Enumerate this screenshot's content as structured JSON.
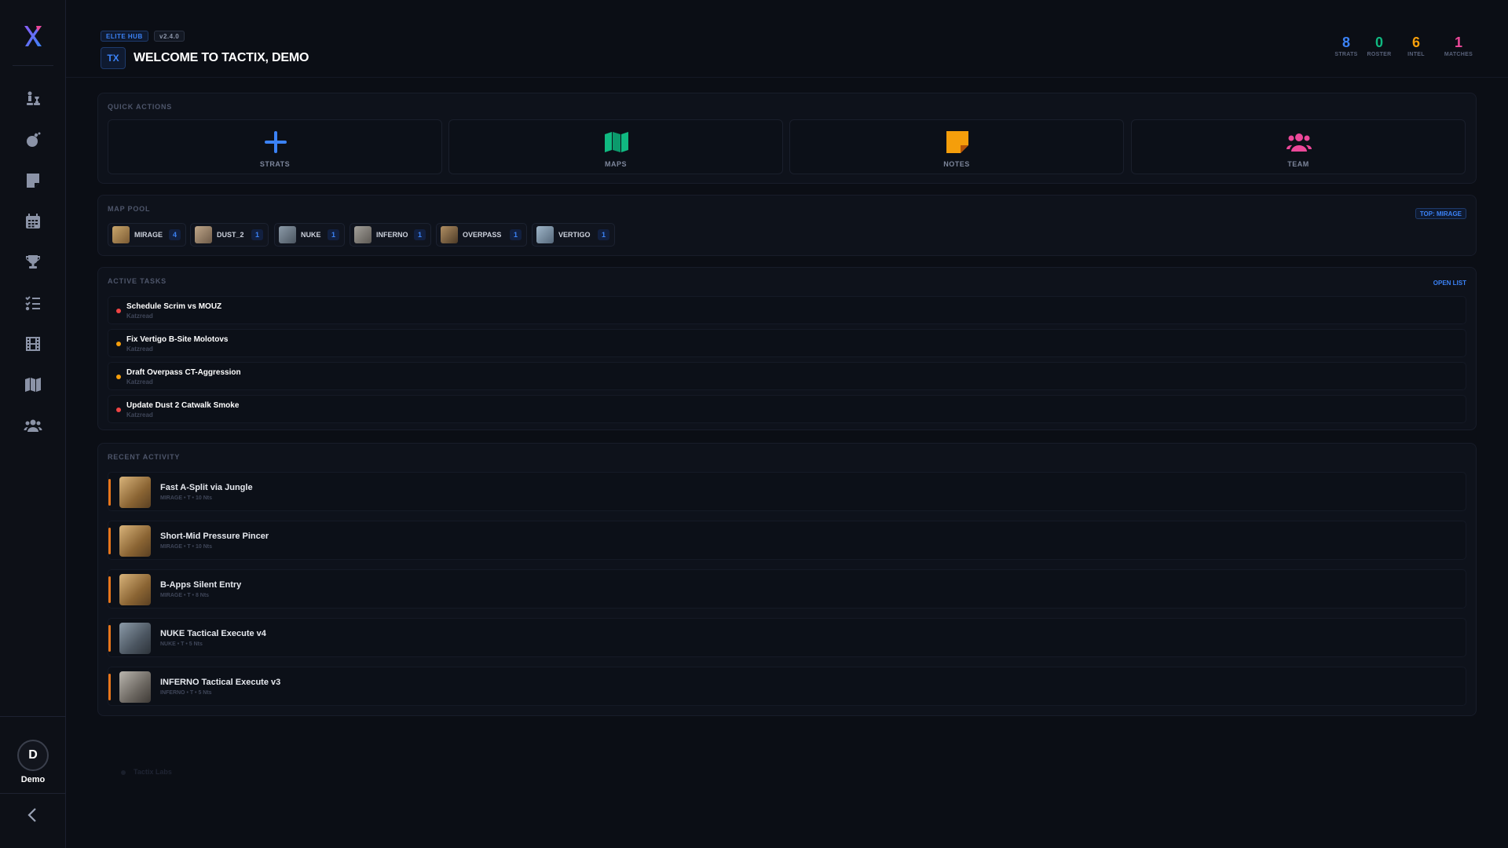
{
  "header": {
    "badge_elite": "ELITE HUB",
    "badge_version": "v2.4.0",
    "tx_box": "TX",
    "welcome": "WELCOME TO TACTIX, DEMO",
    "stats": [
      {
        "value": "8",
        "label": "STRATS",
        "color": "#3b82f6"
      },
      {
        "value": "0",
        "label": "ROSTER",
        "color": "#10b981"
      },
      {
        "value": "6",
        "label": "INTEL",
        "color": "#f59e0b"
      },
      {
        "value": "1",
        "label": "MATCHES",
        "color": "#ec4899"
      }
    ]
  },
  "sidebar": {
    "items": [
      {
        "icon": "chess-icon"
      },
      {
        "icon": "grenade-icon"
      },
      {
        "icon": "note-icon"
      },
      {
        "icon": "calendar-icon"
      },
      {
        "icon": "trophy-icon"
      },
      {
        "icon": "task-list-icon"
      },
      {
        "icon": "film-icon"
      },
      {
        "icon": "map-icon"
      },
      {
        "icon": "users-icon"
      }
    ],
    "avatar_letter": "D",
    "user_name": "Demo"
  },
  "quick_actions": {
    "title": "QUICK ACTIONS",
    "items": [
      {
        "label": "STRATS",
        "icon": "plus-icon",
        "color": "#3b82f6"
      },
      {
        "label": "MAPS",
        "icon": "map-icon",
        "color": "#10b981"
      },
      {
        "label": "NOTES",
        "icon": "sticky-note-icon",
        "color": "#f59e0b"
      },
      {
        "label": "TEAM",
        "icon": "team-icon",
        "color": "#ec4899"
      }
    ]
  },
  "map_pool": {
    "title": "MAP POOL",
    "top_badge": "TOP: MIRAGE",
    "maps": [
      {
        "name": "MIRAGE",
        "count": "4"
      },
      {
        "name": "DUST_2",
        "count": "1"
      },
      {
        "name": "NUKE",
        "count": "1"
      },
      {
        "name": "INFERNO",
        "count": "1"
      },
      {
        "name": "OVERPASS",
        "count": "1"
      },
      {
        "name": "VERTIGO",
        "count": "1"
      }
    ]
  },
  "tasks": {
    "title": "ACTIVE TASKS",
    "open_list": "OPEN LIST",
    "items": [
      {
        "title": "Schedule Scrim vs MOUZ",
        "sub": "Katzread",
        "color": "#ef4444"
      },
      {
        "title": "Fix Vertigo B-Site Molotovs",
        "sub": "Katzread",
        "color": "#f59e0b"
      },
      {
        "title": "Draft Overpass CT-Aggression",
        "sub": "Katzread",
        "color": "#f59e0b"
      },
      {
        "title": "Update Dust 2 Catwalk Smoke",
        "sub": "Katzread",
        "color": "#ef4444"
      }
    ]
  },
  "activity": {
    "title": "RECENT ACTIVITY",
    "items": [
      {
        "title": "Fast A-Split via Jungle",
        "sub": "MIRAGE • T • 10 Nts"
      },
      {
        "title": "Short-Mid Pressure Pincer",
        "sub": "MIRAGE • T • 10 Nts"
      },
      {
        "title": "B-Apps Silent Entry",
        "sub": "MIRAGE • T • 8 Nts"
      },
      {
        "title": "NUKE Tactical Execute v4",
        "sub": "NUKE • T • 5 Nts"
      },
      {
        "title": "INFERNO Tactical Execute v3",
        "sub": "INFERNO • T • 5 Nts"
      }
    ]
  },
  "ghost_text": "Tactix Labs"
}
